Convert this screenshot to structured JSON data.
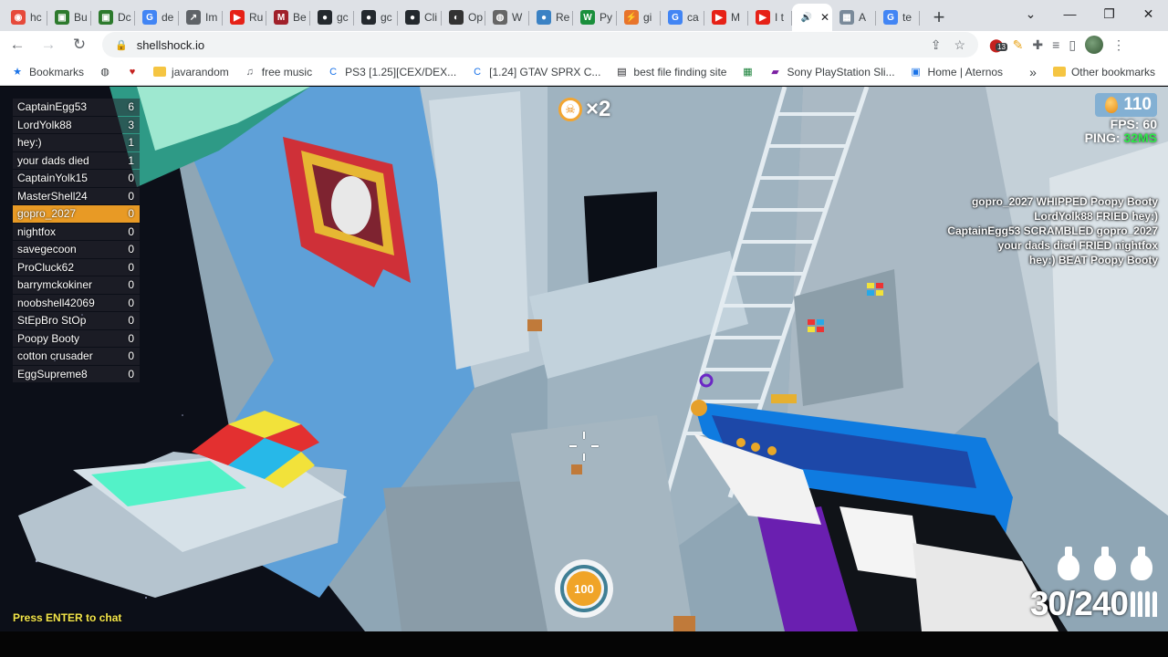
{
  "browser": {
    "tabs": [
      {
        "title": "hc",
        "color": "#e64a3b",
        "glyph": "◉"
      },
      {
        "title": "Bu",
        "color": "#2d7a2d",
        "glyph": "▣"
      },
      {
        "title": "Dc",
        "color": "#2d7a2d",
        "glyph": "▣"
      },
      {
        "title": "de",
        "color": "#4285f4",
        "glyph": "G"
      },
      {
        "title": "Im",
        "color": "#5f6368",
        "glyph": "↗"
      },
      {
        "title": "Ru",
        "color": "#e62117",
        "glyph": "▶"
      },
      {
        "title": "Be",
        "color": "#a0202a",
        "glyph": "M"
      },
      {
        "title": "gc",
        "color": "#24292e",
        "glyph": "●"
      },
      {
        "title": "gc",
        "color": "#24292e",
        "glyph": "●"
      },
      {
        "title": "Cli",
        "color": "#24292e",
        "glyph": "●"
      },
      {
        "title": "Op",
        "color": "#333333",
        "glyph": "◐"
      },
      {
        "title": "W",
        "color": "#666666",
        "glyph": "◍"
      },
      {
        "title": "Re",
        "color": "#3b82c4",
        "glyph": "●"
      },
      {
        "title": "Py",
        "color": "#1a8f3c",
        "glyph": "W"
      },
      {
        "title": "gi",
        "color": "#e8742b",
        "glyph": "⚡"
      },
      {
        "title": "ca",
        "color": "#4285f4",
        "glyph": "G"
      },
      {
        "title": "M",
        "color": "#e62117",
        "glyph": "▶"
      },
      {
        "title": "I t",
        "color": "#e62117",
        "glyph": "▶"
      },
      {
        "title": "",
        "color": "#ffffff",
        "glyph": "🔊",
        "active": true
      },
      {
        "title": "A",
        "color": "#7a8a9a",
        "glyph": "▦"
      },
      {
        "title": "te",
        "color": "#4285f4",
        "glyph": "G"
      }
    ],
    "url": "shellshock.io",
    "bookmarks": [
      {
        "label": "Bookmarks",
        "icon": "star-icon"
      },
      {
        "label": "",
        "icon": "globe-icon"
      },
      {
        "label": "",
        "icon": "heart-icon"
      },
      {
        "label": "javarandom",
        "icon": "folder-icon"
      },
      {
        "label": "free music",
        "icon": "headphones-icon"
      },
      {
        "label": "PS3 [1.25][CEX/DEX...",
        "icon": "c-icon"
      },
      {
        "label": "[1.24] GTAV SPRX C...",
        "icon": "c-icon"
      },
      {
        "label": "best file finding site",
        "icon": "film-icon"
      },
      {
        "label": "",
        "icon": "gallery-icon"
      },
      {
        "label": "Sony PlayStation Sli...",
        "icon": "bag-icon"
      },
      {
        "label": "Home | Aternos",
        "icon": "grid-icon"
      }
    ],
    "other_bookmarks": "Other bookmarks",
    "more": "»",
    "ext_badge": "13"
  },
  "game": {
    "scoreboard": [
      {
        "name": "CaptainEgg53",
        "score": "6"
      },
      {
        "name": "LordYolk88",
        "score": "3"
      },
      {
        "name": "hey:)",
        "score": "1"
      },
      {
        "name": "your dads died",
        "score": "1"
      },
      {
        "name": "CaptainYolk15",
        "score": "0"
      },
      {
        "name": "MasterShell24",
        "score": "0"
      },
      {
        "name": "gopro_2027",
        "score": "0",
        "me": true
      },
      {
        "name": "nightfox",
        "score": "0"
      },
      {
        "name": "savegecoon",
        "score": "0"
      },
      {
        "name": "ProCluck62",
        "score": "0"
      },
      {
        "name": "barrymckokiner",
        "score": "0"
      },
      {
        "name": "noobshell42069",
        "score": "0"
      },
      {
        "name": "StEpBro StOp",
        "score": "0"
      },
      {
        "name": "Poopy Booty",
        "score": "0"
      },
      {
        "name": "cotton crusader",
        "score": "0"
      },
      {
        "name": "EggSupreme8",
        "score": "0"
      }
    ],
    "killfeed": [
      "gopro_2027 WHIPPED Poopy Booty",
      "LordYolk88 FRIED hey:)",
      "CaptainEgg53 SCRAMBLED gopro_2027",
      "your dads died FRIED nightfox",
      "hey:) BEAT Poopy Booty"
    ],
    "eggs": "110",
    "fps_label": "FPS:",
    "fps": "60",
    "ping_label": "PING:",
    "ping": "32MS",
    "streak": "×2",
    "health": "100",
    "ammo": "30/240",
    "grenades": 3,
    "chat_hint": "Press ENTER to chat"
  }
}
